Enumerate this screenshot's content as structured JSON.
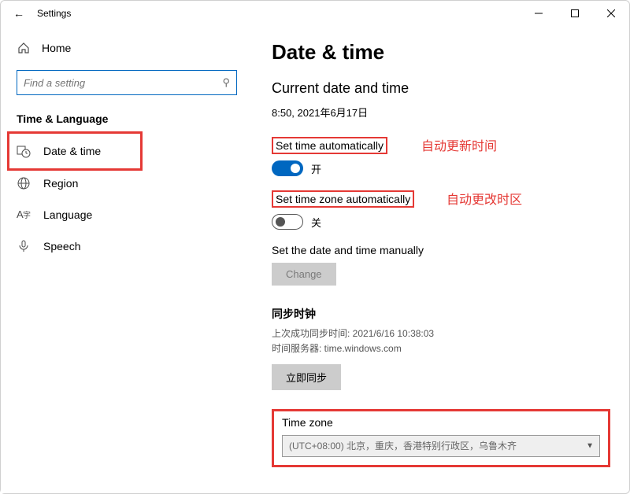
{
  "titlebar": {
    "title": "Settings"
  },
  "sidebar": {
    "home": "Home",
    "search_placeholder": "Find a setting",
    "section": "Time & Language",
    "items": [
      {
        "label": "Date & time",
        "icon": "clock-calendar-icon"
      },
      {
        "label": "Region",
        "icon": "globe-icon"
      },
      {
        "label": "Language",
        "icon": "language-icon"
      },
      {
        "label": "Speech",
        "icon": "mic-icon"
      }
    ]
  },
  "page": {
    "title": "Date & time",
    "current_head": "Current date and time",
    "current_value": "8:50, 2021年6月17日",
    "auto_time": {
      "label": "Set time automatically",
      "state": "开",
      "annotation": "自动更新时间"
    },
    "auto_tz": {
      "label": "Set time zone automatically",
      "state": "关",
      "annotation": "自动更改时区"
    },
    "manual": {
      "label": "Set the date and time manually",
      "button": "Change"
    },
    "sync": {
      "head": "同步时钟",
      "last": "上次成功同步时间: 2021/6/16 10:38:03",
      "server": "时间服务器: time.windows.com",
      "button": "立即同步"
    },
    "timezone": {
      "label": "Time zone",
      "value": "(UTC+08:00) 北京，重庆，香港特别行政区，乌鲁木齐"
    }
  }
}
